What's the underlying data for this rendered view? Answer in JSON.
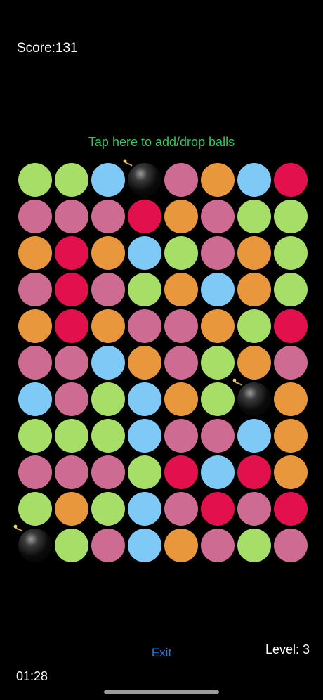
{
  "score": "Score:131",
  "tap_label": "Tap here to add/drop balls",
  "exit_label": "Exit",
  "level_label": "Level:  3",
  "timer": "01:28",
  "colors": {
    "G": "#a6de68",
    "P": "#cd6b92",
    "B": "#7ec9f6",
    "O": "#e9973c",
    "R": "#e2114e"
  },
  "board": [
    [
      "G",
      "G",
      "B",
      "X",
      "P",
      "O",
      "B",
      "R"
    ],
    [
      "P",
      "P",
      "P",
      "R",
      "O",
      "P",
      "G",
      "G"
    ],
    [
      "O",
      "R",
      "O",
      "B",
      "G",
      "P",
      "O",
      "G"
    ],
    [
      "P",
      "R",
      "P",
      "G",
      "O",
      "B",
      "O",
      "G"
    ],
    [
      "O",
      "R",
      "O",
      "P",
      "P",
      "O",
      "G",
      "R"
    ],
    [
      "P",
      "P",
      "B",
      "O",
      "P",
      "G",
      "O",
      "P"
    ],
    [
      "B",
      "P",
      "G",
      "B",
      "O",
      "G",
      "X",
      "O"
    ],
    [
      "G",
      "G",
      "G",
      "B",
      "P",
      "P",
      "B",
      "O"
    ],
    [
      "P",
      "P",
      "P",
      "G",
      "R",
      "B",
      "R",
      "O"
    ],
    [
      "G",
      "O",
      "G",
      "B",
      "P",
      "R",
      "P",
      "R"
    ],
    [
      "X",
      "G",
      "P",
      "B",
      "O",
      "P",
      "G",
      "P"
    ]
  ]
}
